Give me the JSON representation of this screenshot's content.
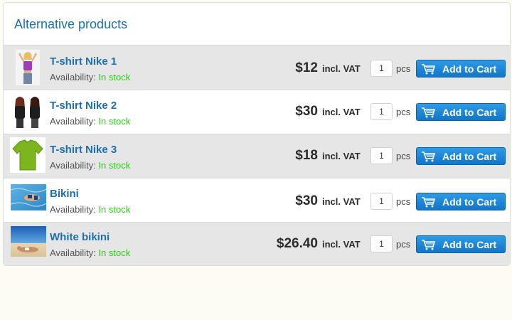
{
  "section": {
    "title": "Alternative products"
  },
  "availability_label": "Availability:",
  "vat_label": "incl. VAT",
  "pcs_label": "pcs",
  "cart_label": "Add to Cart",
  "products": [
    {
      "name": "T-shirt Nike 1",
      "stock": "In stock",
      "price": "$12",
      "qty": "1",
      "thumb": "woman-purple-top"
    },
    {
      "name": "T-shirt Nike 2",
      "stock": "In stock",
      "price": "$30",
      "qty": "1",
      "thumb": "two-women-black-tees"
    },
    {
      "name": "T-shirt Nike 3",
      "stock": "In stock",
      "price": "$18",
      "qty": "1",
      "thumb": "green-tshirt"
    },
    {
      "name": "Bikini",
      "stock": "In stock",
      "price": "$30",
      "qty": "1",
      "thumb": "bikini-pool"
    },
    {
      "name": "White bikini",
      "stock": "In stock",
      "price": "$26.40",
      "qty": "1",
      "thumb": "beach-woman"
    }
  ],
  "colors": {
    "accent": "#1c6fb1",
    "in_stock": "#2ecc1a",
    "button": "#1a85d6",
    "row_shade": "#e6e6e6",
    "page_bg": "#fdfcf3"
  }
}
